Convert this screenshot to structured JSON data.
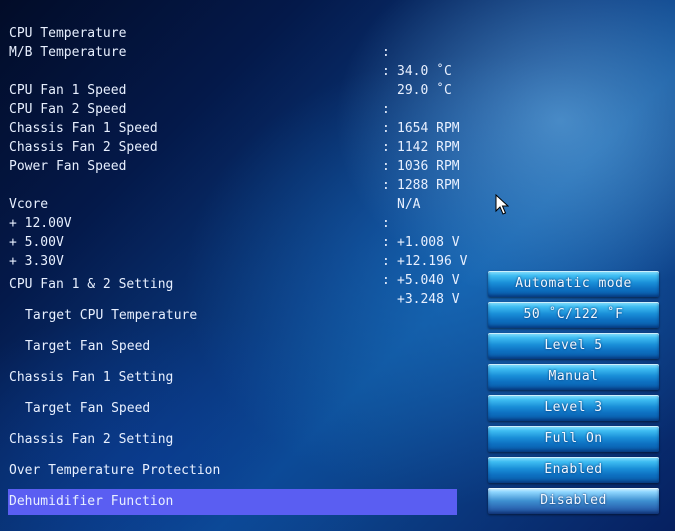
{
  "monitor": {
    "temperatures": [
      {
        "label": "CPU Temperature",
        "value": "34.0 ˚C"
      },
      {
        "label": "M/B Temperature",
        "value": "29.0 ˚C"
      }
    ],
    "fans": [
      {
        "label": "CPU Fan 1 Speed",
        "value": "1654 RPM"
      },
      {
        "label": "CPU Fan 2 Speed",
        "value": "1142 RPM"
      },
      {
        "label": "Chassis Fan 1 Speed",
        "value": "1036 RPM"
      },
      {
        "label": "Chassis Fan 2 Speed",
        "value": "1288 RPM"
      },
      {
        "label": "Power Fan Speed",
        "value": "N/A"
      }
    ],
    "voltages": [
      {
        "label": "Vcore",
        "value": "+1.008 V"
      },
      {
        "label": "+ 12.00V",
        "value": "+12.196 V"
      },
      {
        "label": "+ 5.00V",
        "value": "+5.040 V"
      },
      {
        "label": "+ 3.30V",
        "value": "+3.248 V"
      }
    ],
    "separator": ":"
  },
  "settings": [
    {
      "label": "CPU Fan 1 & 2 Setting",
      "value": "Automatic mode"
    },
    {
      "label": "Target CPU Temperature",
      "value": "50 ˚C/122 ˚F"
    },
    {
      "label": "Target Fan Speed",
      "value": "Level 5"
    },
    {
      "label": "Chassis Fan 1 Setting",
      "value": "Manual"
    },
    {
      "label": "Target Fan Speed",
      "value": "Level 3"
    },
    {
      "label": "Chassis Fan 2 Setting",
      "value": "Full On"
    },
    {
      "label": "Over Temperature Protection",
      "value": "Enabled"
    },
    {
      "label": "Dehumidifier Function",
      "value": "Disabled"
    }
  ],
  "colors": {
    "selection": "#5a5ef2",
    "button": "#1a8fd8",
    "text": "#e8f0ff"
  }
}
